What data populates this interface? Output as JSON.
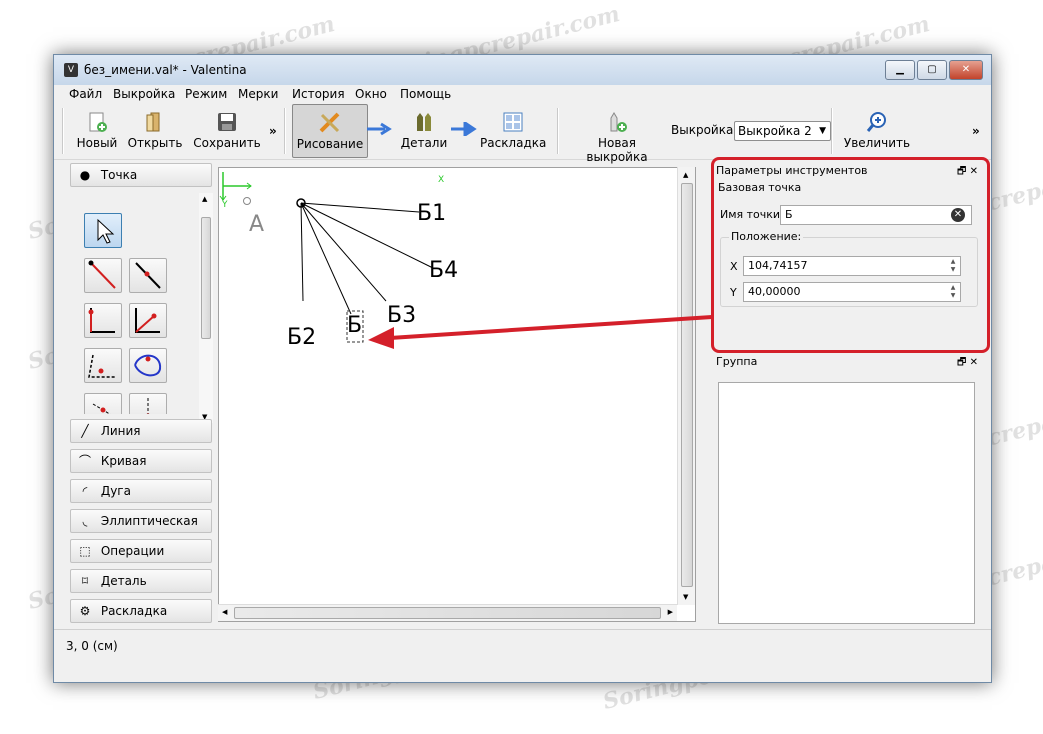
{
  "window": {
    "title": "без_имени.val* - Valentina",
    "minimize": "▁",
    "maximize": "▢",
    "close": "✕"
  },
  "menu": [
    "Файл",
    "Выкройка",
    "Режим",
    "Мерки",
    "История",
    "Окно",
    "Помощь"
  ],
  "toolbar": {
    "new_label": "Новый",
    "open_label": "Открыть",
    "save_label": "Сохранить",
    "more": "»",
    "draw_label": "Рисование",
    "details_label": "Детали",
    "layout_label": "Раскладка",
    "new_pattern_label": "Новая выкройка",
    "pattern_prefix": "Выкройка:",
    "pattern_value": "Выкройка 2",
    "zoom_label": "Увеличить",
    "more2": "»"
  },
  "tools": {
    "point_section": "Точка",
    "sections": [
      "Линия",
      "Кривая",
      "Дуга",
      "Эллиптическая ...",
      "Операции",
      "Деталь",
      "Раскладка"
    ]
  },
  "canvas": {
    "axis_x": "X",
    "axis_y": "Y",
    "point_a": "A",
    "labels": [
      "Б1",
      "Б4",
      "Б3",
      "Б2",
      "Б"
    ]
  },
  "tool_options": {
    "title": "Параметры инструментов",
    "group_title": "Базовая точка",
    "name_label": "Имя точки:",
    "name_value": "Б",
    "position_title": "Положение:",
    "x_label": "X",
    "x_value": "104,74157",
    "y_label": "Y",
    "y_value": "40,00000"
  },
  "group_panel": {
    "title": "Группа"
  },
  "status": {
    "text": "3, 0 (см)"
  },
  "watermark": "Soringpcrepair.com",
  "colors": {
    "highlight": "#d4202a",
    "selected_tool": "#3c7fb1"
  }
}
